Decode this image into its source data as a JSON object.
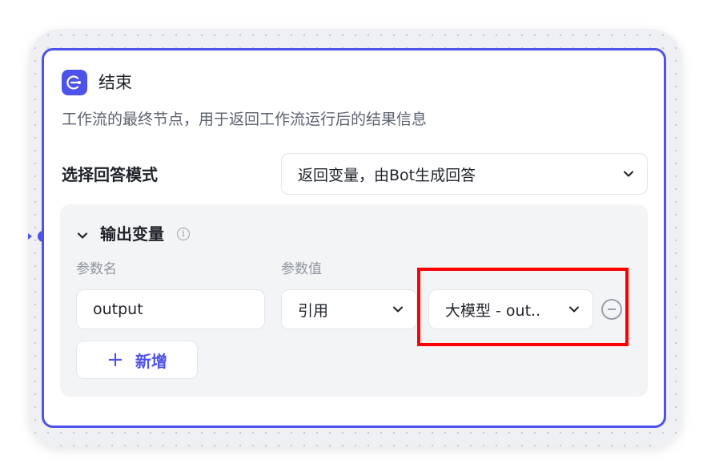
{
  "node": {
    "title": "结束",
    "description": "工作流的最终节点，用于返回工作流运行后的结果信息",
    "icon": "end-node-icon"
  },
  "answer_mode": {
    "label": "选择回答模式",
    "value": "返回变量，由Bot生成回答"
  },
  "output_section": {
    "title": "输出变量",
    "columns": {
      "name": "参数名",
      "value": "参数值"
    },
    "rows": [
      {
        "name": "output",
        "type": "引用",
        "reference": "大模型 - out.."
      }
    ],
    "add_label": "新增"
  },
  "colors": {
    "accent": "#4d53e8",
    "highlight": "#ff0000"
  }
}
